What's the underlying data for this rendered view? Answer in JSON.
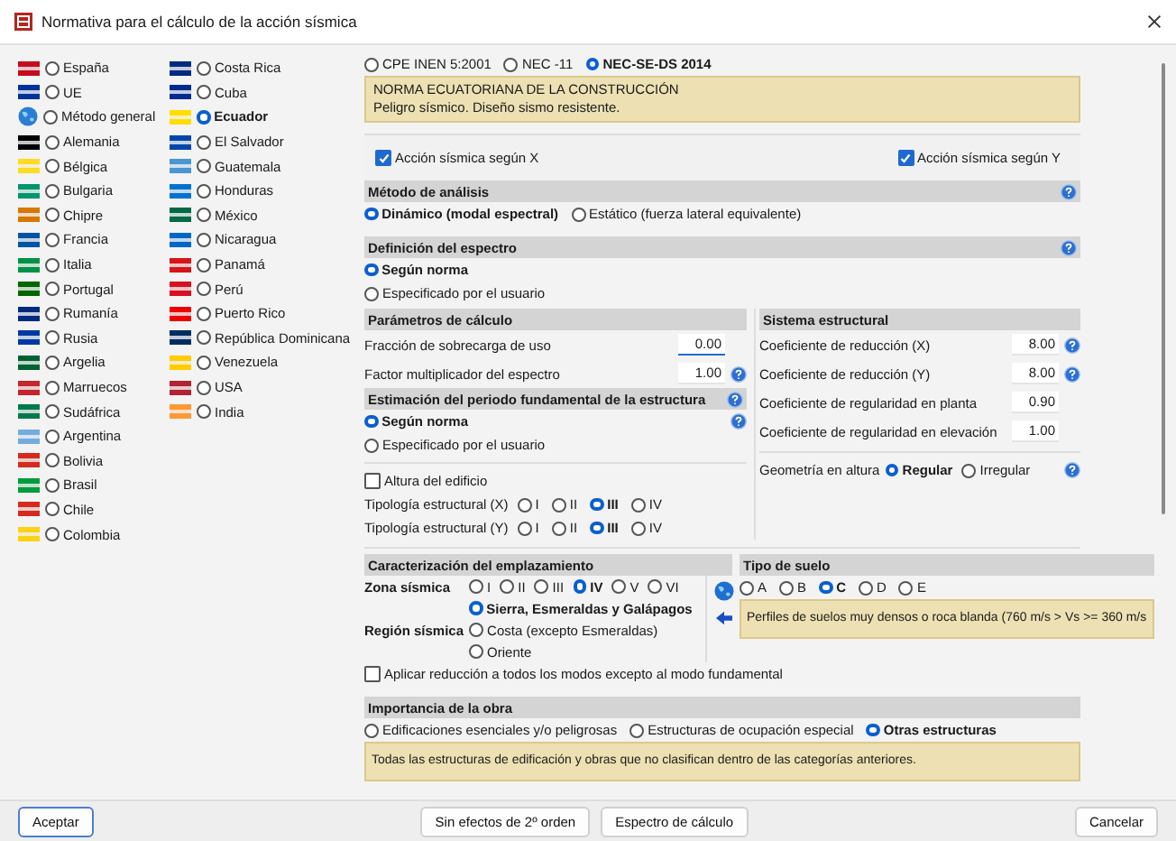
{
  "window": {
    "title": "Normativa para el cálculo de la acción sísmica"
  },
  "countries": [
    {
      "name": "España",
      "selected": false,
      "kind": "flag",
      "color": "#c60b1e"
    },
    {
      "name": "UE",
      "selected": false,
      "kind": "flag",
      "color": "#003399"
    },
    {
      "name": "Método general",
      "selected": false,
      "kind": "globe",
      "color": "#2a7fd4"
    },
    {
      "name": "Alemania",
      "selected": false,
      "kind": "flag",
      "color": "#000000"
    },
    {
      "name": "Bélgica",
      "selected": false,
      "kind": "flag",
      "color": "#fdda24"
    },
    {
      "name": "Bulgaria",
      "selected": false,
      "kind": "flag",
      "color": "#00966e"
    },
    {
      "name": "Chipre",
      "selected": false,
      "kind": "flag",
      "color": "#d57800"
    },
    {
      "name": "Francia",
      "selected": false,
      "kind": "flag",
      "color": "#0055a4"
    },
    {
      "name": "Italia",
      "selected": false,
      "kind": "flag",
      "color": "#009246"
    },
    {
      "name": "Portugal",
      "selected": false,
      "kind": "flag",
      "color": "#006600"
    },
    {
      "name": "Rumanía",
      "selected": false,
      "kind": "flag",
      "color": "#002b7f"
    },
    {
      "name": "Rusia",
      "selected": false,
      "kind": "flag",
      "color": "#0039a6"
    },
    {
      "name": "Argelia",
      "selected": false,
      "kind": "flag",
      "color": "#006233"
    },
    {
      "name": "Marruecos",
      "selected": false,
      "kind": "flag",
      "color": "#c1272d"
    },
    {
      "name": "Sudáfrica",
      "selected": false,
      "kind": "flag",
      "color": "#007a4d"
    },
    {
      "name": "Argentina",
      "selected": false,
      "kind": "flag",
      "color": "#74acdf"
    },
    {
      "name": "Bolivia",
      "selected": false,
      "kind": "flag",
      "color": "#d52b1e"
    },
    {
      "name": "Brasil",
      "selected": false,
      "kind": "flag",
      "color": "#009c3b"
    },
    {
      "name": "Chile",
      "selected": false,
      "kind": "flag",
      "color": "#d52b1e"
    },
    {
      "name": "Colombia",
      "selected": false,
      "kind": "flag",
      "color": "#fcd116"
    },
    {
      "name": "Costa Rica",
      "selected": false,
      "kind": "flag",
      "color": "#002b7f"
    },
    {
      "name": "Cuba",
      "selected": false,
      "kind": "flag",
      "color": "#002a8f"
    },
    {
      "name": "Ecuador",
      "selected": true,
      "kind": "flag",
      "color": "#ffdd00"
    },
    {
      "name": "El Salvador",
      "selected": false,
      "kind": "flag",
      "color": "#0047ab"
    },
    {
      "name": "Guatemala",
      "selected": false,
      "kind": "flag",
      "color": "#4997d0"
    },
    {
      "name": "Honduras",
      "selected": false,
      "kind": "flag",
      "color": "#0073cf"
    },
    {
      "name": "México",
      "selected": false,
      "kind": "flag",
      "color": "#006847"
    },
    {
      "name": "Nicaragua",
      "selected": false,
      "kind": "flag",
      "color": "#0067c6"
    },
    {
      "name": "Panamá",
      "selected": false,
      "kind": "flag",
      "color": "#da121a"
    },
    {
      "name": "Perú",
      "selected": false,
      "kind": "flag",
      "color": "#d91023"
    },
    {
      "name": "Puerto Rico",
      "selected": false,
      "kind": "flag",
      "color": "#ed0000"
    },
    {
      "name": "República Dominicana",
      "selected": false,
      "kind": "flag",
      "color": "#002d62"
    },
    {
      "name": "Venezuela",
      "selected": false,
      "kind": "flag",
      "color": "#ffcc00"
    },
    {
      "name": "USA",
      "selected": false,
      "kind": "flag",
      "color": "#b22234"
    },
    {
      "name": "India",
      "selected": false,
      "kind": "flag",
      "color": "#ff9933"
    }
  ],
  "norms": [
    {
      "label": "CPE INEN 5:2001",
      "selected": false
    },
    {
      "label": "NEC -11",
      "selected": false
    },
    {
      "label": "NEC-SE-DS 2014",
      "selected": true
    }
  ],
  "norm_note": [
    "NORMA ECUATORIANA DE LA CONSTRUCCIÓN",
    "Peligro sísmico. Diseño sismo resistente."
  ],
  "seismic_action": [
    {
      "label": "Acción sísmica según X",
      "checked": true
    },
    {
      "label": "Acción sísmica según Y",
      "checked": true
    }
  ],
  "analysis_method": {
    "title": "Método de análisis",
    "options": [
      {
        "label": "Dinámico (modal espectral)",
        "selected": true
      },
      {
        "label": "Estático (fuerza lateral equivalente)",
        "selected": false
      }
    ]
  },
  "spectrum_definition": {
    "title": "Definición del espectro",
    "options": [
      {
        "label": "Según norma",
        "selected": true
      },
      {
        "label": "Especificado por el usuario",
        "selected": false
      }
    ]
  },
  "calc_params": {
    "title": "Parámetros de cálculo",
    "fields": [
      {
        "label": "Fracción de sobrecarga de uso",
        "value": "0.00",
        "focused": true,
        "help": false
      },
      {
        "label": "Factor multiplicador del espectro",
        "value": "1.00",
        "focused": false,
        "help": true
      }
    ]
  },
  "period": {
    "title": "Estimación del periodo fundamental de la estructura",
    "options": [
      {
        "label": "Según norma",
        "selected": true
      },
      {
        "label": "Especificado por el usuario",
        "selected": false
      }
    ],
    "building_height": {
      "label": "Altura del edificio",
      "checked": false
    },
    "typology": [
      {
        "label": "Tipología estructural (X)",
        "options": [
          {
            "label": "I",
            "selected": false
          },
          {
            "label": "II",
            "selected": false
          },
          {
            "label": "III",
            "selected": true
          },
          {
            "label": "IV",
            "selected": false
          }
        ]
      },
      {
        "label": "Tipología estructural (Y)",
        "options": [
          {
            "label": "I",
            "selected": false
          },
          {
            "label": "II",
            "selected": false
          },
          {
            "label": "III",
            "selected": true
          },
          {
            "label": "IV",
            "selected": false
          }
        ]
      }
    ]
  },
  "structural_system": {
    "title": "Sistema estructural",
    "fields": [
      {
        "label": "Coeficiente de reducción (X)",
        "value": "8.00",
        "help": true
      },
      {
        "label": "Coeficiente de reducción (Y)",
        "value": "8.00",
        "help": true
      },
      {
        "label": "Coeficiente de regularidad en planta",
        "value": "0.90",
        "help": false
      },
      {
        "label": "Coeficiente de regularidad en elevación",
        "value": "1.00",
        "help": false
      }
    ],
    "geometry": {
      "label": "Geometría en altura",
      "options": [
        {
          "label": "Regular",
          "selected": true
        },
        {
          "label": "Irregular",
          "selected": false
        }
      ]
    }
  },
  "site": {
    "title": "Caracterización del emplazamiento",
    "zone": {
      "label": "Zona sísmica",
      "options": [
        {
          "label": "I",
          "selected": false
        },
        {
          "label": "II",
          "selected": false
        },
        {
          "label": "III",
          "selected": false
        },
        {
          "label": "IV",
          "selected": true
        },
        {
          "label": "V",
          "selected": false
        },
        {
          "label": "VI",
          "selected": false
        }
      ]
    },
    "region": {
      "label": "Región sísmica",
      "options": [
        {
          "label": "Sierra, Esmeraldas y Galápagos",
          "selected": true
        },
        {
          "label": "Costa (excepto Esmeraldas)",
          "selected": false
        },
        {
          "label": "Oriente",
          "selected": false
        }
      ]
    },
    "reduction": {
      "label": "Aplicar reducción a todos los modos excepto al modo fundamental",
      "checked": false
    }
  },
  "soil": {
    "title": "Tipo de suelo",
    "options": [
      {
        "label": "A",
        "selected": false
      },
      {
        "label": "B",
        "selected": false
      },
      {
        "label": "C",
        "selected": true
      },
      {
        "label": "D",
        "selected": false
      },
      {
        "label": "E",
        "selected": false
      }
    ],
    "note": "Perfiles de suelos muy densos o roca blanda (760 m/s > Vs >= 360 m/s"
  },
  "importance": {
    "title": "Importancia de la obra",
    "options": [
      {
        "label": "Edificaciones esenciales y/o peligrosas",
        "selected": false
      },
      {
        "label": "Estructuras de ocupación especial",
        "selected": false
      },
      {
        "label": "Otras estructuras",
        "selected": true
      }
    ],
    "note": "Todas las estructuras de edificación y obras que no clasifican dentro de las categorías anteriores."
  },
  "buttons": [
    {
      "label": "Aceptar",
      "kind": "primary"
    },
    {
      "label": "Sin efectos de 2º orden",
      "kind": "center"
    },
    {
      "label": "Espectro de cálculo",
      "kind": "center"
    },
    {
      "label": "Cancelar",
      "kind": "end"
    }
  ]
}
